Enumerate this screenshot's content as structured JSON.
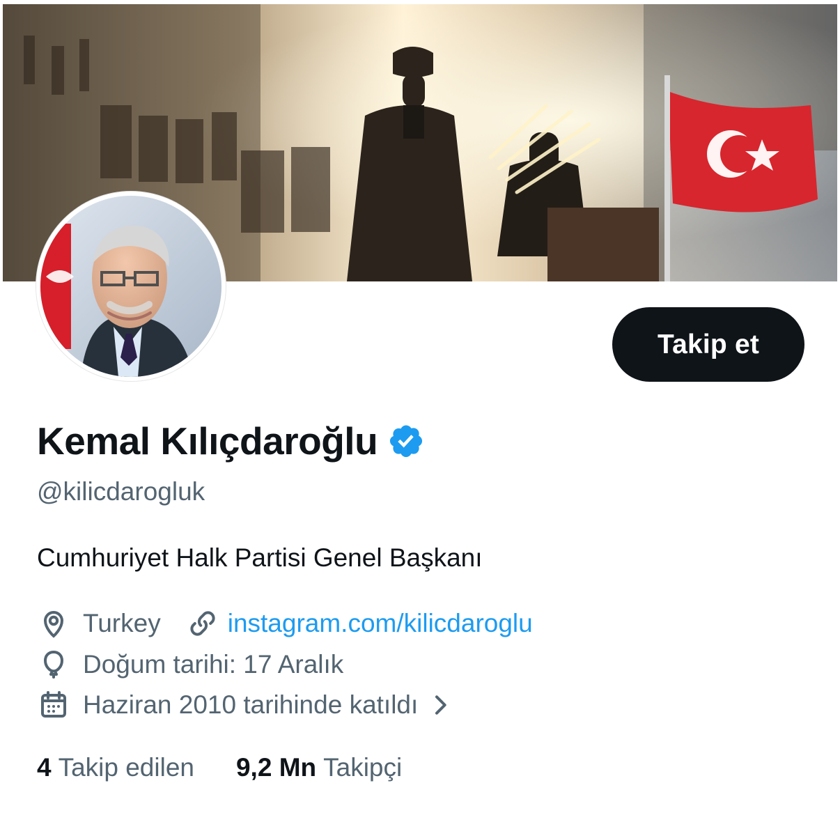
{
  "profile": {
    "display_name": "Kemal Kılıçdaroğlu",
    "handle": "@kilicdarogluk",
    "bio": "Cumhuriyet Halk Partisi Genel Başkanı",
    "location": "Turkey",
    "website": "instagram.com/kilicdaroglu",
    "birth_date": "Doğum tarihi: 17 Aralık",
    "joined": "Haziran 2010 tarihinde katıldı",
    "verified": true
  },
  "actions": {
    "follow_label": "Takip et"
  },
  "stats": {
    "following_count": "4",
    "following_label": "Takip edilen",
    "followers_count": "9,2 Mn",
    "followers_label": "Takipçi"
  },
  "icons": {
    "location": "location-pin-icon",
    "link": "link-icon",
    "birthday": "balloon-icon",
    "calendar": "calendar-icon",
    "chevron": "chevron-right-icon",
    "verified": "verified-badge-icon"
  },
  "colors": {
    "primary_text": "#0f1419",
    "secondary_text": "#536471",
    "link": "#1d9bf0",
    "button_bg": "#0f1419",
    "button_text": "#ffffff"
  }
}
